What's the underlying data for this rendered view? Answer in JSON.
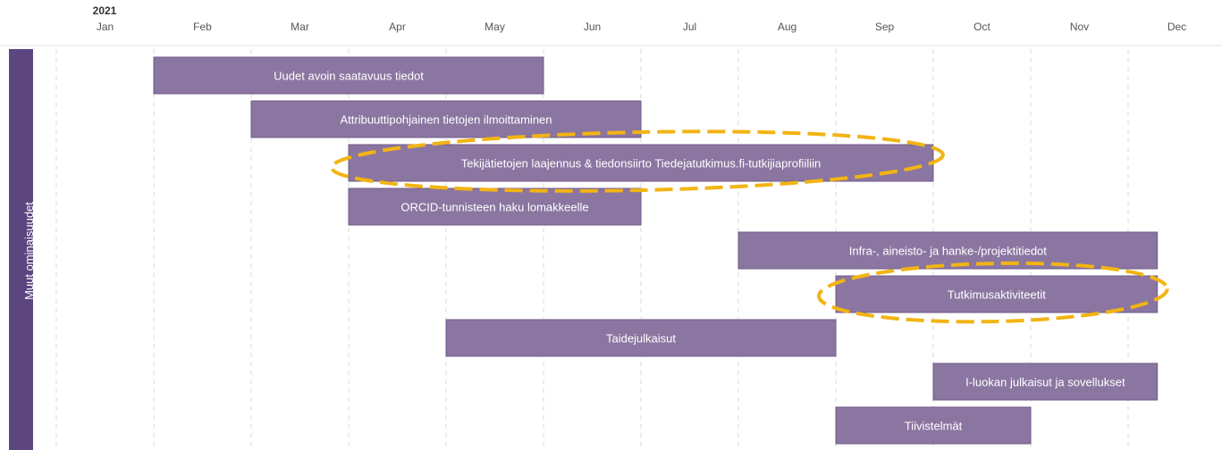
{
  "chart_data": {
    "type": "gantt",
    "year": "2021",
    "months": [
      "Jan",
      "Feb",
      "Mar",
      "Apr",
      "May",
      "Jun",
      "Jul",
      "Aug",
      "Sep",
      "Oct",
      "Nov",
      "Dec"
    ],
    "lane": "Muut ominaisuudet",
    "tasks": [
      {
        "label": "Uudet avoin saatavuus tiedot",
        "start": 2.0,
        "end": 6.0
      },
      {
        "label": "Attribuuttipohjainen tietojen ilmoittaminen",
        "start": 3.0,
        "end": 7.0
      },
      {
        "label": "Tekijätietojen laajennus & tiedonsiirto Tiedejatutkimus.fi-tutkijiaprofiiliin",
        "start": 4.0,
        "end": 10.0,
        "highlighted": true
      },
      {
        "label": "ORCID-tunnisteen haku lomakkeelle",
        "start": 4.0,
        "end": 7.0
      },
      {
        "label": "Infra-, aineisto- ja hanke-/projektitiedot",
        "start": 8.0,
        "end": 12.3
      },
      {
        "label": "Tutkimusaktiviteetit",
        "start": 9.0,
        "end": 12.3,
        "highlighted": true
      },
      {
        "label": "Taidejulkaisut",
        "start": 5.0,
        "end": 9.0
      },
      {
        "label": "I-luokan julkaisut ja sovellukset",
        "start": 10.0,
        "end": 12.3
      },
      {
        "label": "Tiivistelmät",
        "start": 9.0,
        "end": 11.0
      }
    ],
    "colors": {
      "bar": "#8b76a1",
      "bar_border": "#6f5a88",
      "lane": "#5d4580",
      "highlight": "#f2b413",
      "grid": "#d9d9d9"
    }
  }
}
